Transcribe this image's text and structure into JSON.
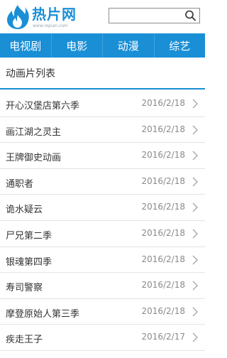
{
  "header": {
    "logo_text": "热片网",
    "logo_url": "www.repian.com",
    "search": {
      "value": "",
      "placeholder": ""
    }
  },
  "nav": {
    "items": [
      {
        "label": "电视剧"
      },
      {
        "label": "电影"
      },
      {
        "label": "动漫"
      },
      {
        "label": "综艺"
      }
    ]
  },
  "section": {
    "title": "动画片列表"
  },
  "list": {
    "items": [
      {
        "title": "开心汉堡店第六季",
        "date": "2016/2/18"
      },
      {
        "title": "画江湖之灵主",
        "date": "2016/2/18"
      },
      {
        "title": "王牌御史动画",
        "date": "2016/2/18"
      },
      {
        "title": "通职者",
        "date": "2016/2/18"
      },
      {
        "title": "诡水疑云",
        "date": "2016/2/18"
      },
      {
        "title": "尸兄第二季",
        "date": "2016/2/18"
      },
      {
        "title": "银魂第四季",
        "date": "2016/2/18"
      },
      {
        "title": "寿司警察",
        "date": "2016/2/18"
      },
      {
        "title": "摩登原始人第三季",
        "date": "2016/2/18"
      },
      {
        "title": "疾走王子",
        "date": "2016/2/17"
      }
    ]
  },
  "colors": {
    "brand": "#1a8fd6",
    "divider": "#e3e3e3",
    "date": "#8a8a8a"
  },
  "icons": [
    "flame-logo-icon",
    "search-icon",
    "chevron-right-icon"
  ]
}
